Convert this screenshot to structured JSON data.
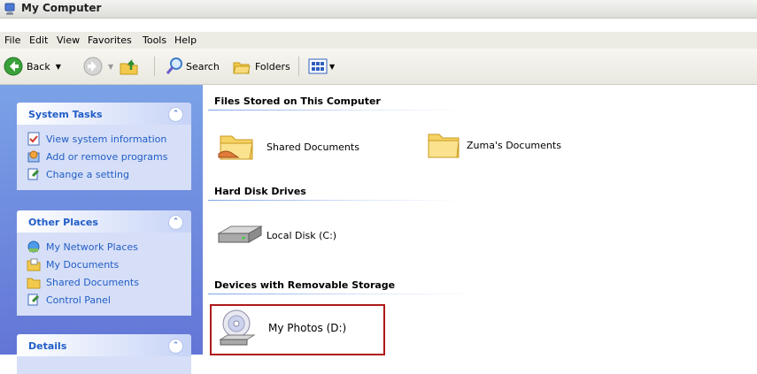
{
  "window": {
    "title": "My Computer",
    "icon": "my-computer-icon"
  },
  "menu": [
    "File",
    "Edit",
    "View",
    "Favorites",
    "Tools",
    "Help"
  ],
  "toolbar": {
    "back": "Back",
    "search": "Search",
    "folders": "Folders"
  },
  "left": {
    "system_tasks": {
      "title": "System Tasks",
      "items": [
        "View system information",
        "Add or remove programs",
        "Change a setting"
      ]
    },
    "other_places": {
      "title": "Other Places",
      "items": [
        "My Network Places",
        "My Documents",
        "Shared Documents",
        "Control Panel"
      ]
    },
    "details": {
      "title": "Details"
    }
  },
  "main": {
    "groups": [
      {
        "title": "Files Stored on This Computer",
        "items": [
          "Shared Documents",
          "Zuma's Documents"
        ]
      },
      {
        "title": "Hard Disk Drives",
        "items": [
          "Local Disk (C:)"
        ]
      },
      {
        "title": "Devices with Removable Storage",
        "items": [
          "My Photos (D:)"
        ]
      }
    ]
  },
  "colors": {
    "link_blue": "#215dc6",
    "pane_blue": "#6375d6",
    "highlight_red": "#b01818"
  }
}
